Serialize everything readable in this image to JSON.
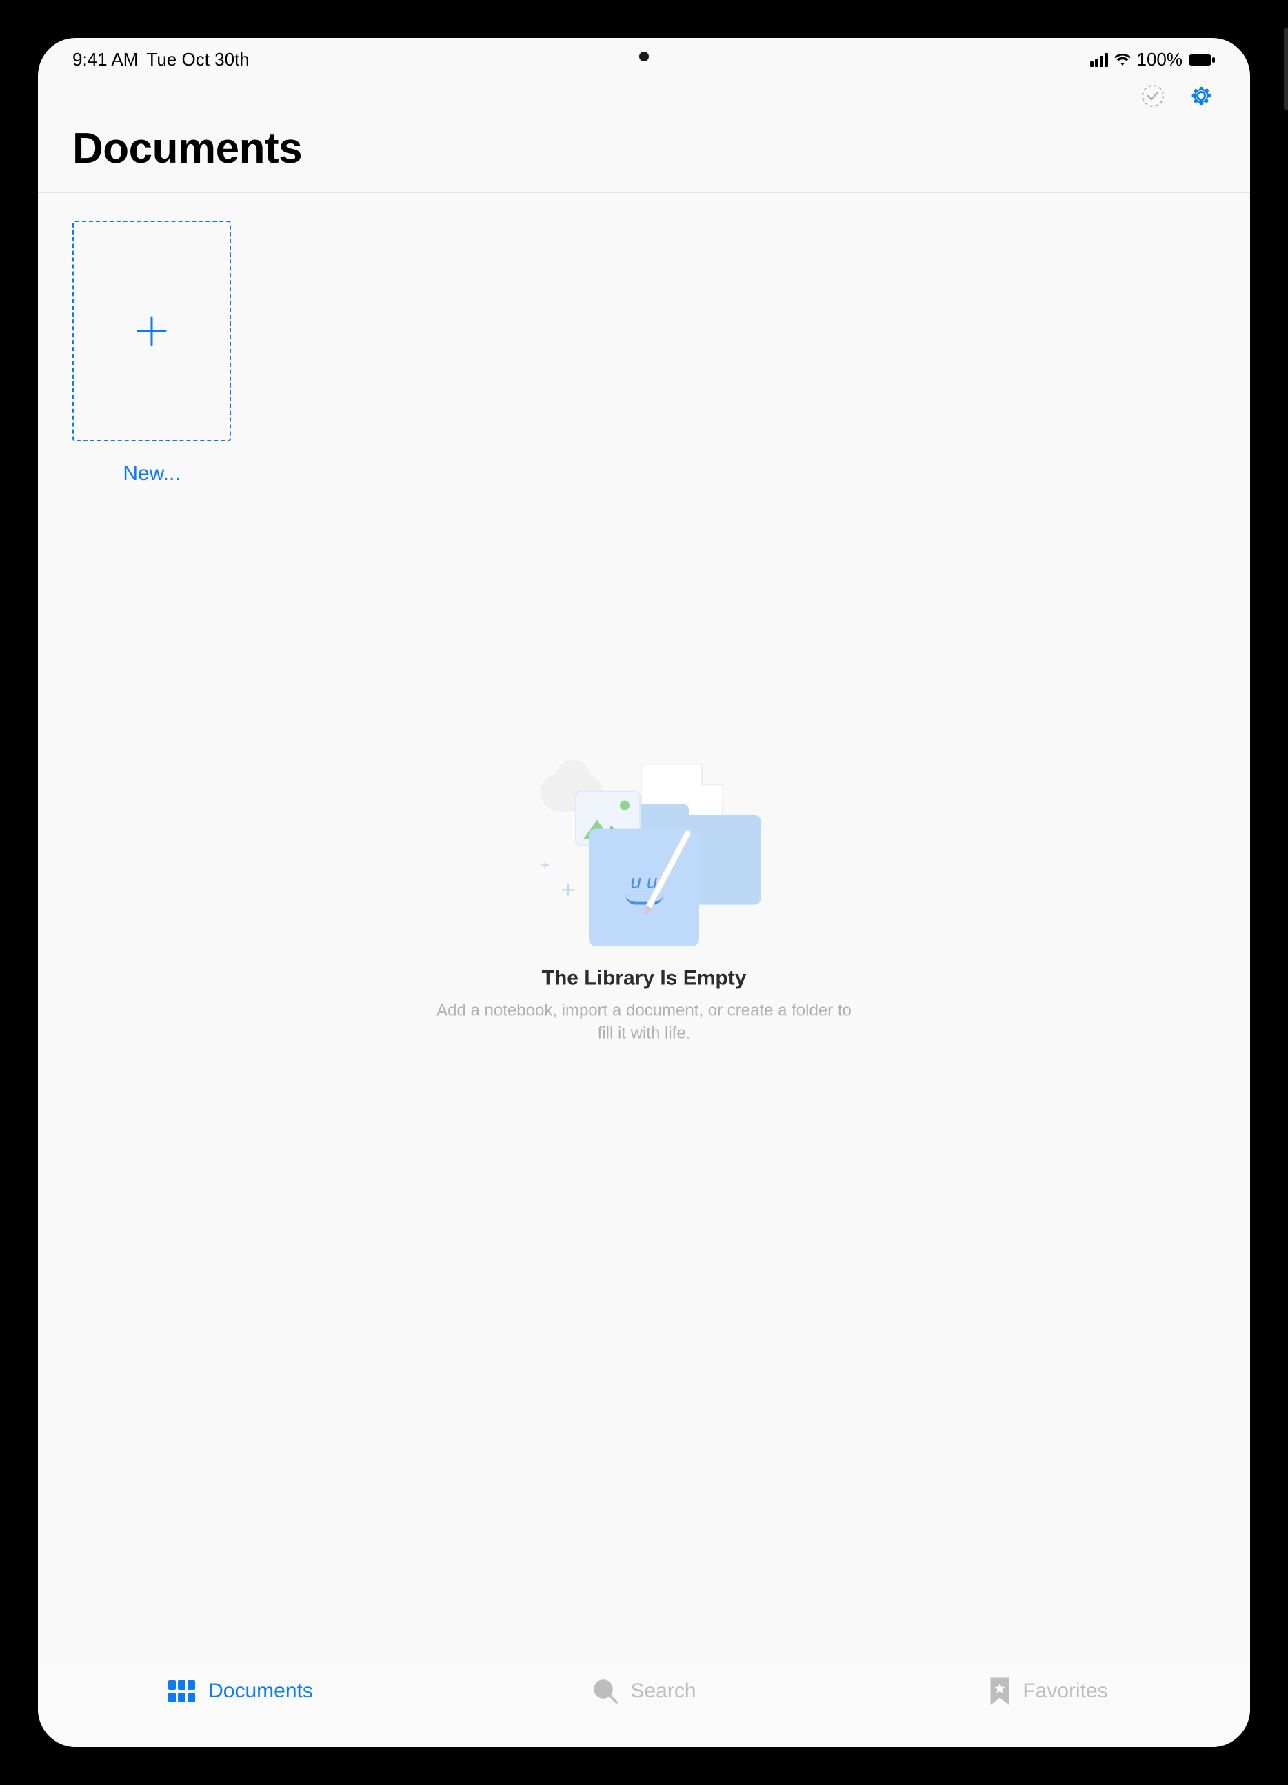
{
  "status": {
    "time": "9:41 AM",
    "date": "Tue Oct 30th",
    "battery_text": "100%"
  },
  "header": {
    "title": "Documents"
  },
  "newTile": {
    "label": "New..."
  },
  "emptyState": {
    "title": "The Library Is Empty",
    "subtitle": "Add a notebook, import a document, or create a folder to fill it with life.",
    "face_text": "u u"
  },
  "tabs": {
    "documents": "Documents",
    "search": "Search",
    "favorites": "Favorites"
  }
}
